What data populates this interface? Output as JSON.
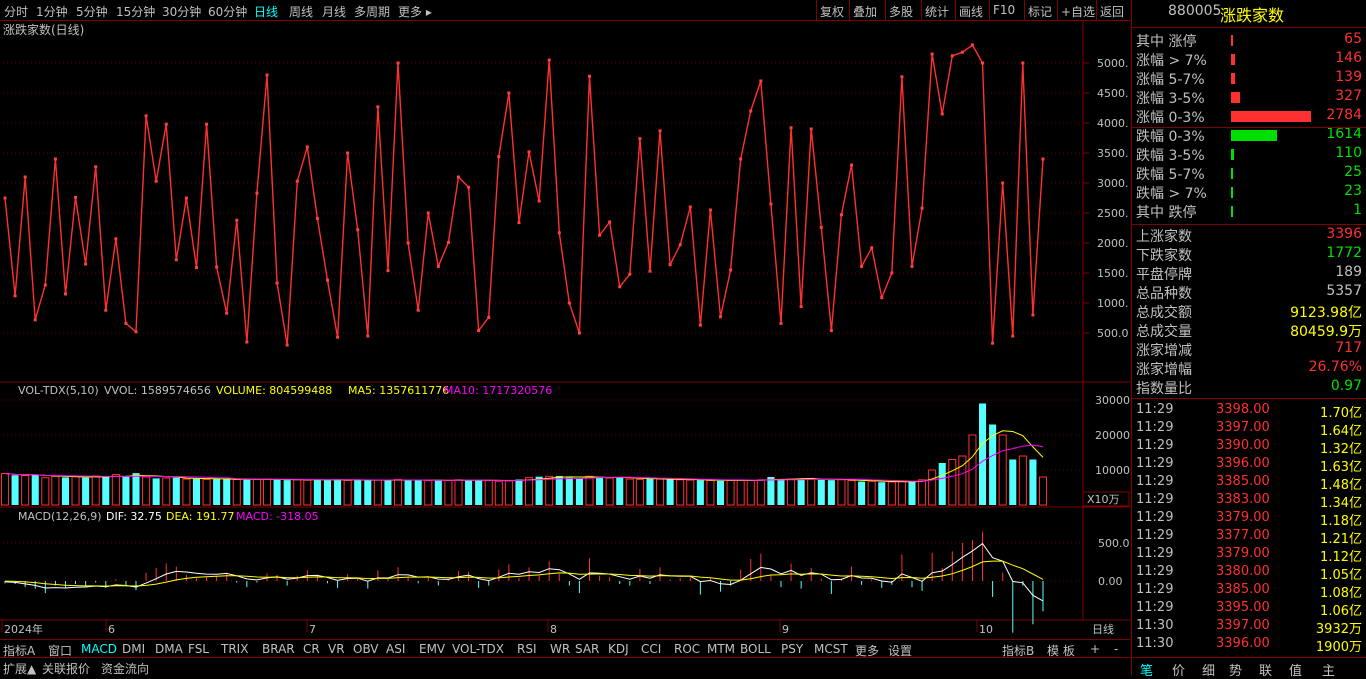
{
  "toolbar": {
    "periods": [
      "分时",
      "1分钟",
      "5分钟",
      "15分钟",
      "30分钟",
      "60分钟",
      "日线",
      "周线",
      "月线",
      "多周期",
      "更多 ▸"
    ],
    "active_period": "日线",
    "actions": [
      "复权",
      "叠加",
      "多股",
      "统计",
      "画线",
      "F10",
      "标记",
      "+自选",
      "返回"
    ]
  },
  "main_chart": {
    "title": "涨跌家数(日线)",
    "y_ticks": [
      "5000.",
      "4500.",
      "4000.",
      "3500.",
      "3000.",
      "2500.",
      "2000.",
      "1500.",
      "1000.",
      "500.0"
    ],
    "line_color": "#ff3030"
  },
  "volume_panel": {
    "title": "VOL-TDX(5,10)",
    "vvol": "VVOL: 1589574656",
    "volume": "VOLUME: 804599488",
    "ma5": "MA5: 1357611776",
    "ma10": "MA10: 1717320576",
    "y_ticks": [
      "30000",
      "20000",
      "10000"
    ],
    "unit": "X10万"
  },
  "macd_panel": {
    "title": "MACD(12,26,9)",
    "dif": "DIF: 32.75",
    "dea": "DEA: 191.77",
    "macd": "MACD: -318.05",
    "y_ticks": [
      "500.0",
      "0.00"
    ]
  },
  "x_axis": {
    "labels": [
      "2024年",
      "6",
      "7",
      "8",
      "9",
      "10"
    ],
    "period_label": "日线"
  },
  "indicator_tabs": [
    "指标A",
    "窗口",
    "MACD",
    "DMI",
    "DMA",
    "FSL",
    "TRIX",
    "BRAR",
    "CR",
    "VR",
    "OBV",
    "ASI",
    "EMV",
    "VOL-TDX",
    "RSI",
    "WR",
    "SAR",
    "KDJ",
    "CCI",
    "ROC",
    "MTM",
    "BOLL",
    "PSY",
    "MCST",
    "更多",
    "设置"
  ],
  "active_indicator": "MACD",
  "indicator_right": [
    "指标B",
    "模 板",
    "+",
    "-"
  ],
  "bottom_tabs": [
    "扩展▲",
    "关联报价",
    "资金流向"
  ],
  "right_panel": {
    "code": "880005",
    "name": "涨跌家数",
    "dist": [
      {
        "label": "其中 涨停",
        "value": "65",
        "color": "#ff3030",
        "frac": 0.023
      },
      {
        "label": "涨幅 > 7%",
        "value": "146",
        "color": "#ff3030",
        "frac": 0.052
      },
      {
        "label": "涨幅 5-7%",
        "value": "139",
        "color": "#ff3030",
        "frac": 0.05
      },
      {
        "label": "涨幅 3-5%",
        "value": "327",
        "color": "#ff3030",
        "frac": 0.117
      },
      {
        "label": "涨幅 0-3%",
        "value": "2784",
        "color": "#ff3030",
        "frac": 1.0
      },
      {
        "label": "跌幅 0-3%",
        "value": "1614",
        "color": "#00e000",
        "frac": 0.58
      },
      {
        "label": "跌幅 3-5%",
        "value": "110",
        "color": "#00e000",
        "frac": 0.04
      },
      {
        "label": "跌幅 5-7%",
        "value": "25",
        "color": "#00e000",
        "frac": 0.009
      },
      {
        "label": "跌幅 > 7%",
        "value": "23",
        "color": "#00e000",
        "frac": 0.008
      },
      {
        "label": "其中 跌停",
        "value": "1",
        "color": "#00e000",
        "frac": 0.001
      }
    ],
    "stats": [
      {
        "label": "上涨家数",
        "value": "3396",
        "color": "#ff3030"
      },
      {
        "label": "下跌家数",
        "value": "1772",
        "color": "#00e000"
      },
      {
        "label": "平盘停牌",
        "value": "189",
        "color": "#c0c0c0"
      },
      {
        "label": "总品种数",
        "value": "5357",
        "color": "#c0c0c0"
      },
      {
        "label": "总成交额",
        "value": "9123.98亿",
        "color": "#ffff00"
      },
      {
        "label": "总成交量",
        "value": "80459.9万",
        "color": "#ffff00"
      },
      {
        "label": "涨家增减",
        "value": "717",
        "color": "#ff3030"
      },
      {
        "label": "涨家增幅",
        "value": "26.76%",
        "color": "#ff3030"
      },
      {
        "label": "指数量比",
        "value": "0.97",
        "color": "#00e000"
      }
    ],
    "ticks": [
      {
        "time": "11:29",
        "price": "3398.00",
        "amount": "1.70亿"
      },
      {
        "time": "11:29",
        "price": "3397.00",
        "amount": "1.64亿"
      },
      {
        "time": "11:29",
        "price": "3390.00",
        "amount": "1.32亿"
      },
      {
        "time": "11:29",
        "price": "3396.00",
        "amount": "1.63亿"
      },
      {
        "time": "11:29",
        "price": "3385.00",
        "amount": "1.48亿"
      },
      {
        "time": "11:29",
        "price": "3383.00",
        "amount": "1.34亿"
      },
      {
        "time": "11:29",
        "price": "3379.00",
        "amount": "1.18亿"
      },
      {
        "time": "11:29",
        "price": "3377.00",
        "amount": "1.21亿"
      },
      {
        "time": "11:29",
        "price": "3379.00",
        "amount": "1.12亿"
      },
      {
        "time": "11:29",
        "price": "3380.00",
        "amount": "1.05亿"
      },
      {
        "time": "11:29",
        "price": "3385.00",
        "amount": "1.08亿"
      },
      {
        "time": "11:29",
        "price": "3395.00",
        "amount": "1.06亿"
      },
      {
        "time": "11:30",
        "price": "3397.00",
        "amount": "3932万"
      },
      {
        "time": "11:30",
        "price": "3396.00",
        "amount": "1900万"
      }
    ],
    "bottom_buttons": [
      "笔",
      "价",
      "细",
      "势",
      "联",
      "值",
      "主"
    ]
  },
  "chart_data": [
    {
      "type": "line",
      "title": "涨跌家数(日线)",
      "ylim": [
        0,
        5500
      ],
      "values": [
        2750,
        1120,
        3100,
        720,
        1300,
        3400,
        1150,
        2760,
        1650,
        3270,
        880,
        2070,
        660,
        520,
        4120,
        3030,
        3980,
        1720,
        2750,
        1590,
        3980,
        1600,
        830,
        2380,
        350,
        2830,
        4800,
        1330,
        300,
        3030,
        3600,
        2410,
        1380,
        430,
        3500,
        2220,
        450,
        4270,
        1540,
        5000,
        2000,
        880,
        2500,
        1610,
        2010,
        3100,
        2930,
        540,
        760,
        3440,
        4500,
        2340,
        3520,
        2700,
        5050,
        2170,
        1000,
        500,
        4780,
        2130,
        2350,
        1270,
        1480,
        3740,
        1530,
        3870,
        1640,
        1970,
        2600,
        630,
        2550,
        770,
        1550,
        3400,
        4200,
        4700,
        2650,
        660,
        3920,
        940,
        3900,
        2260,
        540,
        2470,
        3300,
        1610,
        1920,
        1090,
        1500,
        4770,
        1610,
        2580,
        5150,
        4150,
        5120,
        5180,
        5300,
        5000,
        330,
        3000,
        450,
        5000,
        800,
        3400
      ],
      "note_units": "count"
    },
    {
      "type": "bar",
      "title": "VOL-TDX(5,10)",
      "ylim": [
        0,
        30000
      ],
      "values": [
        9000,
        8500,
        8400,
        8600,
        7800,
        8200,
        7900,
        8100,
        7800,
        8300,
        8000,
        8700,
        8200,
        9100,
        8000,
        7600,
        7700,
        7800,
        7400,
        7500,
        7300,
        7500,
        7400,
        7300,
        7200,
        7300,
        7400,
        7300,
        7100,
        7200,
        7100,
        7300,
        7200,
        7300,
        7000,
        7100,
        7000,
        7100,
        7200,
        7300,
        7000,
        7100,
        7000,
        7100,
        7000,
        7200,
        7000,
        7100,
        7000,
        6800,
        6900,
        7300,
        7800,
        8100,
        8200,
        8300,
        7800,
        7600,
        8200,
        8000,
        7700,
        7800,
        7400,
        7300,
        7500,
        7400,
        7300,
        7200,
        7100,
        7100,
        7000,
        6900,
        7000,
        7100,
        7000,
        7200,
        8000,
        7300,
        7400,
        7500,
        7600,
        7200,
        7100,
        7200,
        7000,
        6700,
        6800,
        6500,
        6600,
        6700,
        6600,
        7200,
        10000,
        12000,
        13000,
        14000,
        20000,
        29000,
        23000,
        20000,
        13000,
        14000,
        13000,
        8000
      ],
      "ma5_color": "#ffff00",
      "ma10_color": "#ff00ff"
    },
    {
      "type": "bar",
      "title": "MACD(12,26,9)",
      "ylim": [
        -700,
        800
      ],
      "values": [
        -30,
        -40,
        -80,
        -100,
        -160,
        -60,
        -90,
        -40,
        -60,
        -20,
        -90,
        20,
        -70,
        -120,
        110,
        170,
        230,
        190,
        80,
        40,
        50,
        70,
        110,
        -20,
        -80,
        -20,
        100,
        80,
        -60,
        70,
        140,
        70,
        -30,
        -90,
        90,
        40,
        -100,
        140,
        30,
        180,
        60,
        -30,
        60,
        -60,
        10,
        130,
        120,
        -90,
        -60,
        150,
        220,
        40,
        180,
        70,
        260,
        90,
        -60,
        -160,
        300,
        70,
        50,
        -40,
        -60,
        160,
        -40,
        180,
        20,
        40,
        50,
        -180,
        40,
        -140,
        -60,
        150,
        290,
        360,
        80,
        -80,
        230,
        -100,
        170,
        30,
        -170,
        30,
        190,
        -50,
        20,
        -90,
        -50,
        350,
        -80,
        -130,
        370,
        170,
        390,
        500,
        540,
        650,
        -210,
        110,
        -680,
        -60,
        -570,
        -400
      ],
      "dif_color": "#ffffff",
      "dea_color": "#ffff00"
    }
  ]
}
